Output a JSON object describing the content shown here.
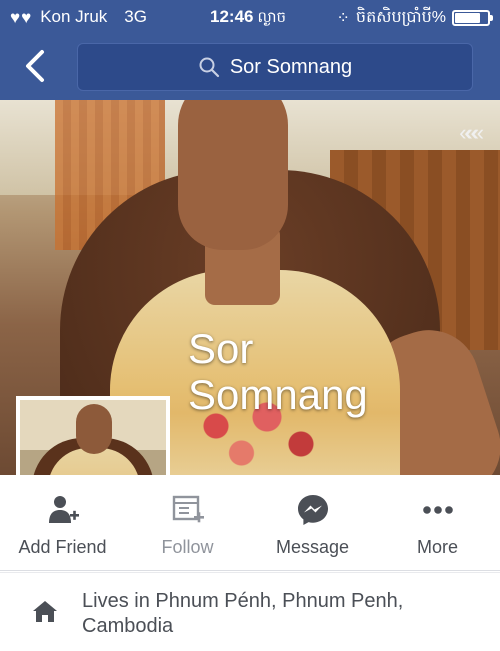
{
  "status_bar": {
    "carrier": "Kon Jruk",
    "network": "3G",
    "time": "12:46",
    "time_suffix": "ល្ងាច",
    "right_text": "ចិតសិបប្រាំបី%",
    "battery_level": 0.78
  },
  "nav": {
    "search_value": "Sor Somnang"
  },
  "profile": {
    "name_line1": "Sor",
    "name_line2": "Somnang"
  },
  "actions": [
    {
      "label": "Add Friend",
      "icon": "add-friend-icon"
    },
    {
      "label": "Follow",
      "icon": "follow-icon"
    },
    {
      "label": "Message",
      "icon": "messenger-icon"
    },
    {
      "label": "More",
      "icon": "more-icon"
    }
  ],
  "about": {
    "lives_in": "Lives in Phnum Pénh, Phnum Penh, Cambodia"
  },
  "colors": {
    "brand_blue": "#3b5998",
    "action_icon": "#4b4f56"
  }
}
